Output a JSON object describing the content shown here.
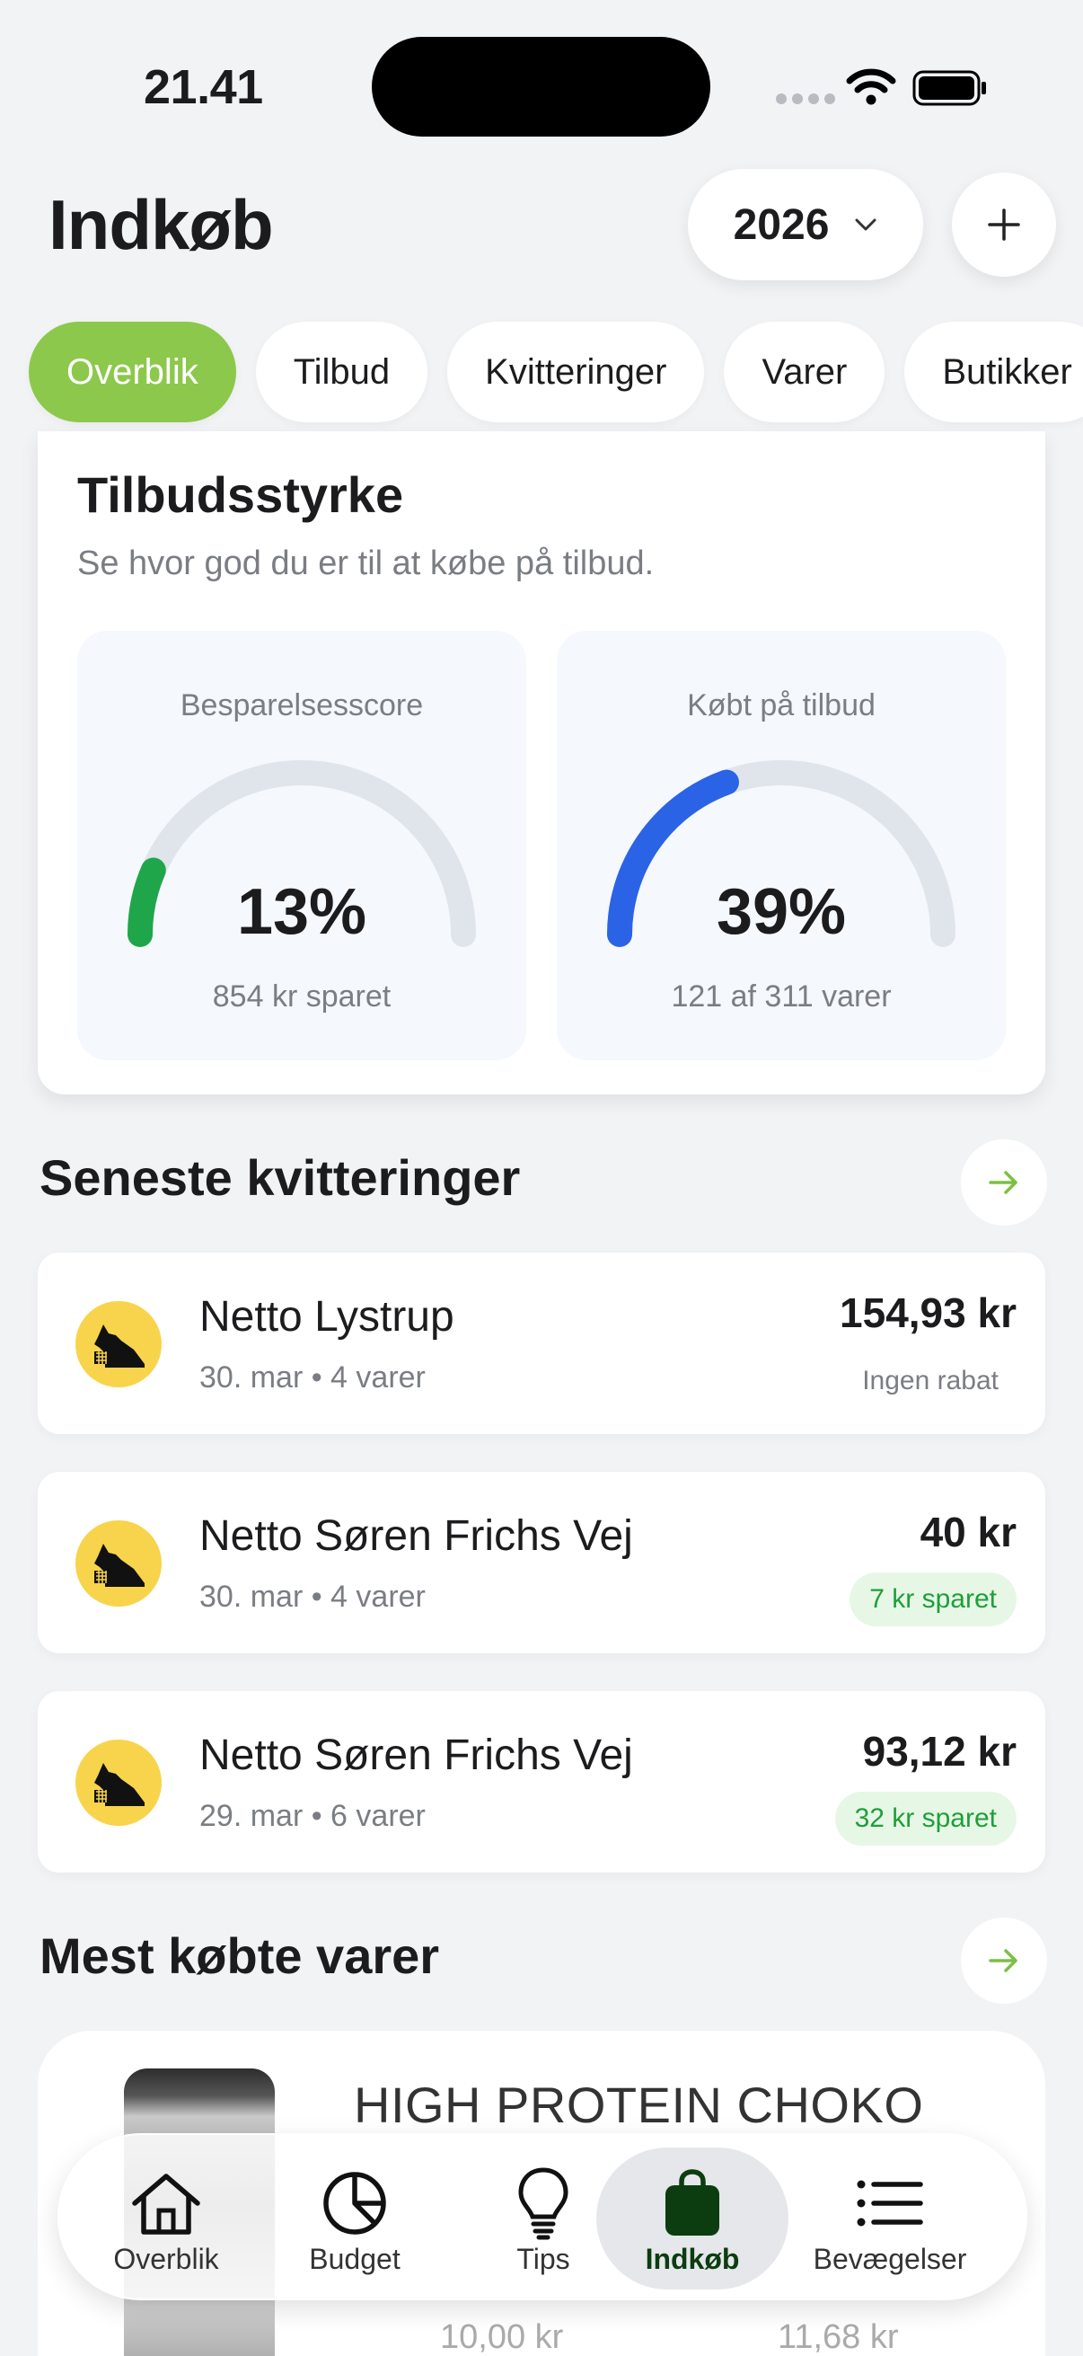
{
  "status": {
    "time": "21.41"
  },
  "header": {
    "title": "Indkøb",
    "year": "2026"
  },
  "tabs": [
    {
      "label": "Overblik",
      "active": true
    },
    {
      "label": "Tilbud"
    },
    {
      "label": "Kvitteringer"
    },
    {
      "label": "Varer"
    },
    {
      "label": "Butikker"
    }
  ],
  "offer_strength": {
    "title": "Tilbudsstyrke",
    "subtitle": "Se hvor god du er til at købe på tilbud.",
    "savings_score": {
      "label": "Besparelsesscore",
      "value": "13%",
      "fraction": 0.13,
      "caption": "854 kr sparet",
      "color": "#1fa64a"
    },
    "bought_on_offer": {
      "label": "Købt på tilbud",
      "value": "39%",
      "fraction": 0.39,
      "caption": "121 af 311 varer",
      "color": "#2b63e6"
    }
  },
  "receipts": {
    "title": "Seneste kvitteringer",
    "items": [
      {
        "store": "Netto Lystrup",
        "meta": "30. mar • 4 varer",
        "amount": "154,93 kr",
        "note": "Ingen rabat"
      },
      {
        "store": "Netto Søren Frichs Vej",
        "meta": "30. mar • 4 varer",
        "amount": "40 kr",
        "saved": "7 kr sparet"
      },
      {
        "store": "Netto Søren Frichs Vej",
        "meta": "29. mar • 6 varer",
        "amount": "93,12 kr",
        "saved": "32 kr sparet"
      }
    ]
  },
  "most_bought": {
    "title": "Mest købte varer",
    "product": {
      "name": "HIGH PROTEIN CHOKO",
      "price_left": "10,00 kr",
      "price_right": "11,68 kr"
    }
  },
  "nav": [
    {
      "label": "Overblik",
      "icon": "home-icon"
    },
    {
      "label": "Budget",
      "icon": "pie-chart-icon"
    },
    {
      "label": "Tips",
      "icon": "lightbulb-icon"
    },
    {
      "label": "Indkøb",
      "icon": "shopping-bag-icon",
      "active": true
    },
    {
      "label": "Bevægelser",
      "icon": "list-icon"
    }
  ]
}
